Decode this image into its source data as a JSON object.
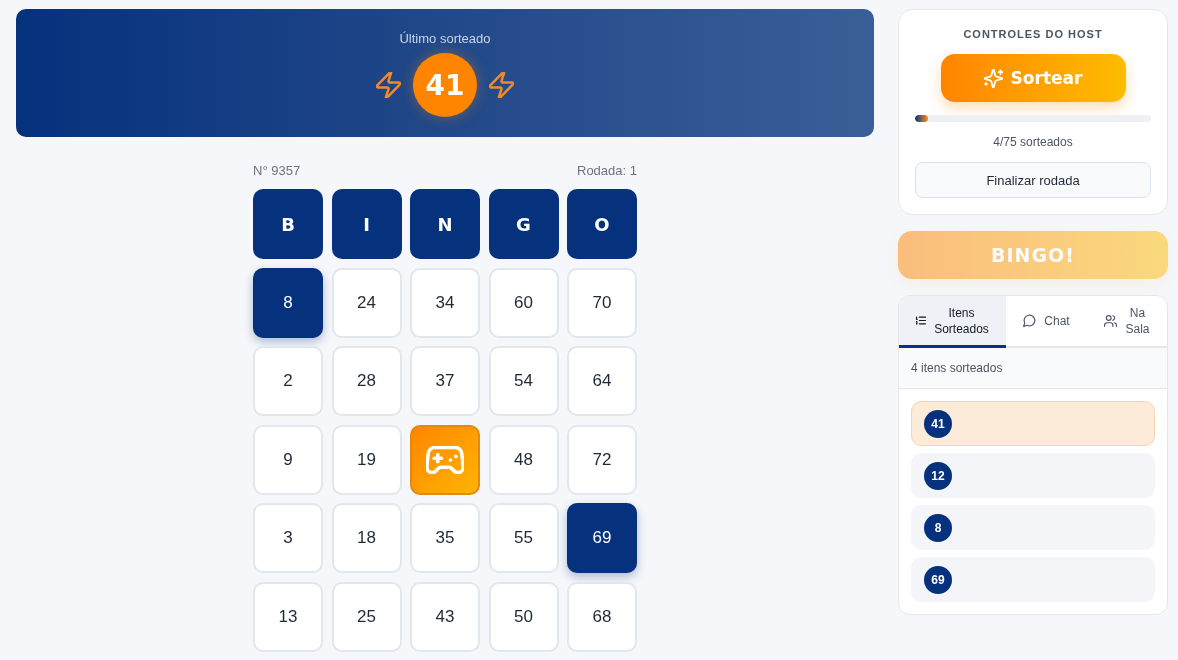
{
  "last_drawn": {
    "label": "Último sorteado",
    "number": "41"
  },
  "card": {
    "number_label": "N° 9357",
    "round_label": "Rodada: 1",
    "columns": [
      "B",
      "I",
      "N",
      "G",
      "O"
    ],
    "rows": [
      [
        {
          "kind": "number",
          "value": "8",
          "marked": true
        },
        {
          "kind": "number",
          "value": "24",
          "marked": false
        },
        {
          "kind": "number",
          "value": "34",
          "marked": false
        },
        {
          "kind": "number",
          "value": "60",
          "marked": false
        },
        {
          "kind": "number",
          "value": "70",
          "marked": false
        }
      ],
      [
        {
          "kind": "number",
          "value": "2",
          "marked": false
        },
        {
          "kind": "number",
          "value": "28",
          "marked": false
        },
        {
          "kind": "number",
          "value": "37",
          "marked": false
        },
        {
          "kind": "number",
          "value": "54",
          "marked": false
        },
        {
          "kind": "number",
          "value": "64",
          "marked": false
        }
      ],
      [
        {
          "kind": "number",
          "value": "9",
          "marked": false
        },
        {
          "kind": "number",
          "value": "19",
          "marked": false
        },
        {
          "kind": "free"
        },
        {
          "kind": "number",
          "value": "48",
          "marked": false
        },
        {
          "kind": "number",
          "value": "72",
          "marked": false
        }
      ],
      [
        {
          "kind": "number",
          "value": "3",
          "marked": false
        },
        {
          "kind": "number",
          "value": "18",
          "marked": false
        },
        {
          "kind": "number",
          "value": "35",
          "marked": false
        },
        {
          "kind": "number",
          "value": "55",
          "marked": false
        },
        {
          "kind": "number",
          "value": "69",
          "marked": true
        }
      ],
      [
        {
          "kind": "number",
          "value": "13",
          "marked": false
        },
        {
          "kind": "number",
          "value": "25",
          "marked": false
        },
        {
          "kind": "number",
          "value": "43",
          "marked": false
        },
        {
          "kind": "number",
          "value": "50",
          "marked": false
        },
        {
          "kind": "number",
          "value": "68",
          "marked": false
        }
      ]
    ]
  },
  "host_controls": {
    "title": "CONTROLES DO HOST",
    "draw_button": "Sortear",
    "progress": {
      "level": 0.053
    },
    "progress_label": "4/75 sorteados",
    "finish_button": "Finalizar rodada"
  },
  "bingo_button": {
    "label": "BINGO!",
    "disabled": true
  },
  "tabs": [
    {
      "kind": "list",
      "label": "Itens Sorteados",
      "selected": true
    },
    {
      "kind": "chat",
      "label": "Chat",
      "selected": false
    },
    {
      "kind": "people",
      "label": "Na Sala",
      "selected": false
    }
  ],
  "draw_history": {
    "count_label": "4 itens sorteados",
    "items": [
      {
        "number": "41",
        "latest": true
      },
      {
        "number": "12",
        "latest": false
      },
      {
        "number": "8",
        "latest": false
      },
      {
        "number": "69",
        "latest": false
      }
    ]
  }
}
